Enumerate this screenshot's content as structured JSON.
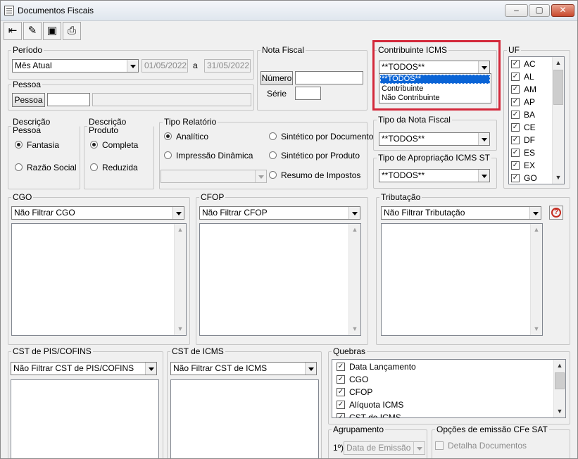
{
  "window": {
    "title": "Documentos Fiscais",
    "minimize": "‒",
    "maximize": "▢",
    "close": "✕"
  },
  "toolbar": {
    "exit_icon": "exit-door-icon",
    "edit_icon": "pencil-icon",
    "save_icon": "floppy-disk-icon",
    "print_icon": "printer-icon"
  },
  "periodo": {
    "legend": "Período",
    "selected": "Mês Atual",
    "date_from": "01/05/2022",
    "separator": "a",
    "date_to": "31/05/2022"
  },
  "pessoa": {
    "legend": "Pessoa",
    "button": "Pessoa",
    "code": "",
    "name": ""
  },
  "nota_fiscal": {
    "legend": "Nota Fiscal",
    "numero_button": "Número",
    "numero_value": "",
    "serie_label": "Série",
    "serie_value": ""
  },
  "contribuinte": {
    "legend": "Contribuinte ICMS",
    "selected": "**TODOS**",
    "options": [
      "**TODOS**",
      "Contribuinte",
      "Não Contribuinte"
    ]
  },
  "tipo_nota": {
    "legend": "Tipo da Nota Fiscal",
    "selected": "**TODOS**"
  },
  "tipo_apropriacao": {
    "legend": "Tipo de Apropriação ICMS ST",
    "selected": "**TODOS**"
  },
  "uf": {
    "legend": "UF",
    "items": [
      "AC",
      "AL",
      "AM",
      "AP",
      "BA",
      "CE",
      "DF",
      "ES",
      "EX",
      "GO"
    ]
  },
  "descricao_pessoa": {
    "legend": "Descrição Pessoa",
    "options": [
      "Fantasia",
      "Razão Social"
    ],
    "selected": "Fantasia"
  },
  "descricao_produto": {
    "legend": "Descrição Produto",
    "options": [
      "Completa",
      "Reduzida"
    ],
    "selected": "Completa"
  },
  "tipo_relatorio": {
    "legend": "Tipo Relatório",
    "options": [
      "Analítico",
      "Impressão Dinâmica",
      "Sintético por Documento",
      "Sintético por Produto",
      "Resumo de Impostos"
    ],
    "selected": "Analítico",
    "combo_value": ""
  },
  "cgo": {
    "legend": "CGO",
    "selected": "Não Filtrar CGO"
  },
  "cfop": {
    "legend": "CFOP",
    "selected": "Não Filtrar CFOP"
  },
  "tributacao": {
    "legend": "Tributação",
    "selected": "Não Filtrar Tributação",
    "help_icon": "question-mark-icon"
  },
  "cst_pis": {
    "legend": "CST de PIS/COFINS",
    "selected": "Não Filtrar CST de PIS/COFINS"
  },
  "cst_icms": {
    "legend": "CST de ICMS",
    "selected": "Não Filtrar CST de ICMS"
  },
  "quebras": {
    "legend": "Quebras",
    "items": [
      "Data Lançamento",
      "CGO",
      "CFOP",
      "Alíquota ICMS",
      "CST de ICMS"
    ]
  },
  "agrupamento": {
    "legend": "Agrupamento",
    "label": "1º)",
    "selected": "Data de Emissão"
  },
  "cfe_sat": {
    "legend": "Opções de emissão CFe SAT",
    "checkbox_label": "Detalha Documentos"
  }
}
